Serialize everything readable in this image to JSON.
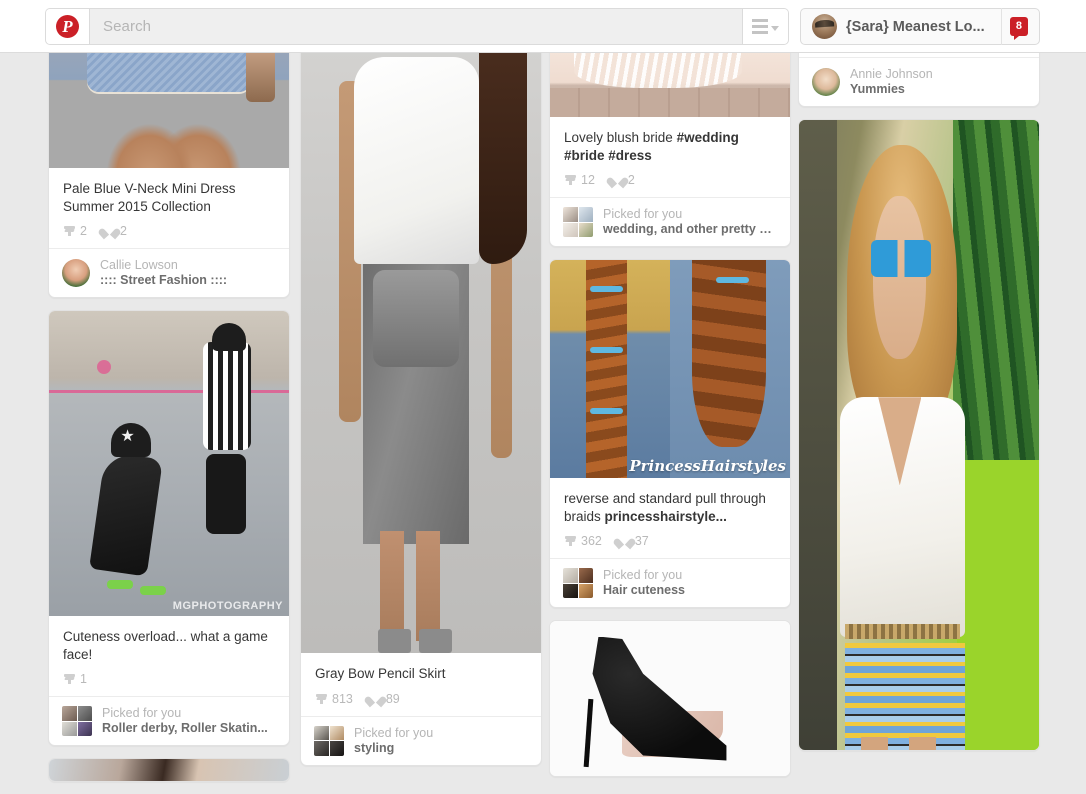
{
  "header": {
    "logo_icon": "pinterest-logo-icon",
    "search": {
      "placeholder": "Search",
      "value": ""
    },
    "menu_icon": "hamburger-menu-icon",
    "user": {
      "name": "{Sara} Meanest Lo...",
      "notification_count": "8",
      "avatar_icon": "user-avatar"
    }
  },
  "columns": [
    {
      "id": "column-1",
      "cards": [
        {
          "title": "Pale Blue V-Neck Mini Dress Summer 2015 Collection",
          "repins": "2",
          "likes": "2",
          "footer_type": "user",
          "footer_name": "Callie Lowson",
          "footer_board": ":::: Street Fashion ::::",
          "image_kind": "legs-blue-dress",
          "watermark": ""
        },
        {
          "title": "Cuteness overload... what a game face!",
          "repins": "1",
          "likes": "",
          "footer_type": "picked",
          "footer_name": "Picked for you",
          "footer_board": "Roller derby, Roller Skatin...",
          "image_kind": "roller-derby",
          "watermark": "MGPHOTOGRAPHY"
        },
        {
          "title": "",
          "repins": "",
          "likes": "",
          "footer_type": "none",
          "footer_name": "",
          "footer_board": "",
          "image_kind": "woman-partial",
          "watermark": ""
        }
      ]
    },
    {
      "id": "column-2",
      "cards": [
        {
          "title": "Gray Bow Pencil Skirt",
          "repins": "813",
          "likes": "89",
          "footer_type": "picked",
          "footer_name": "Picked for you",
          "footer_board": "styling",
          "image_kind": "gray-bow-skirt",
          "watermark": ""
        }
      ]
    },
    {
      "id": "column-3",
      "cards": [
        {
          "title_html": "Lovely blush bride <b>#wedding</b> <b>#bride</b> <b>#dress</b>",
          "title": "Lovely blush bride #wedding #bride #dress",
          "repins": "12",
          "likes": "2",
          "footer_type": "picked",
          "footer_name": "Picked for you",
          "footer_board": "wedding, and other pretty …",
          "image_kind": "blush-bride",
          "watermark": ""
        },
        {
          "title_html": "reverse and standard pull through braids <b>princesshairstyle...</b>",
          "title": "reverse and standard pull through braids princesshairstyle...",
          "repins": "362",
          "likes": "37",
          "footer_type": "picked",
          "footer_name": "Picked for you",
          "footer_board": "Hair cuteness",
          "image_kind": "braids",
          "watermark": "PrincessHairstyles"
        },
        {
          "title": "",
          "repins": "",
          "likes": "",
          "footer_type": "none",
          "footer_name": "",
          "footer_board": "",
          "image_kind": "black-heel",
          "watermark": ""
        }
      ]
    },
    {
      "id": "column-4",
      "cards": [
        {
          "title": "",
          "repins": "",
          "likes": "",
          "footer_type": "user",
          "footer_name": "Annie Johnson",
          "footer_board": "Yummies",
          "image_kind": "none",
          "watermark": ""
        },
        {
          "title": "",
          "repins": "",
          "likes": "",
          "footer_type": "none",
          "footer_name": "",
          "footer_board": "",
          "image_kind": "blonde-woman-skirt",
          "watermark": ""
        }
      ]
    }
  ],
  "colors": {
    "brand_red": "#cb2027",
    "page_bg": "#e9e9e9",
    "card_bg": "#ffffff",
    "title_text": "#363636",
    "muted_text": "#b5b5b5"
  }
}
